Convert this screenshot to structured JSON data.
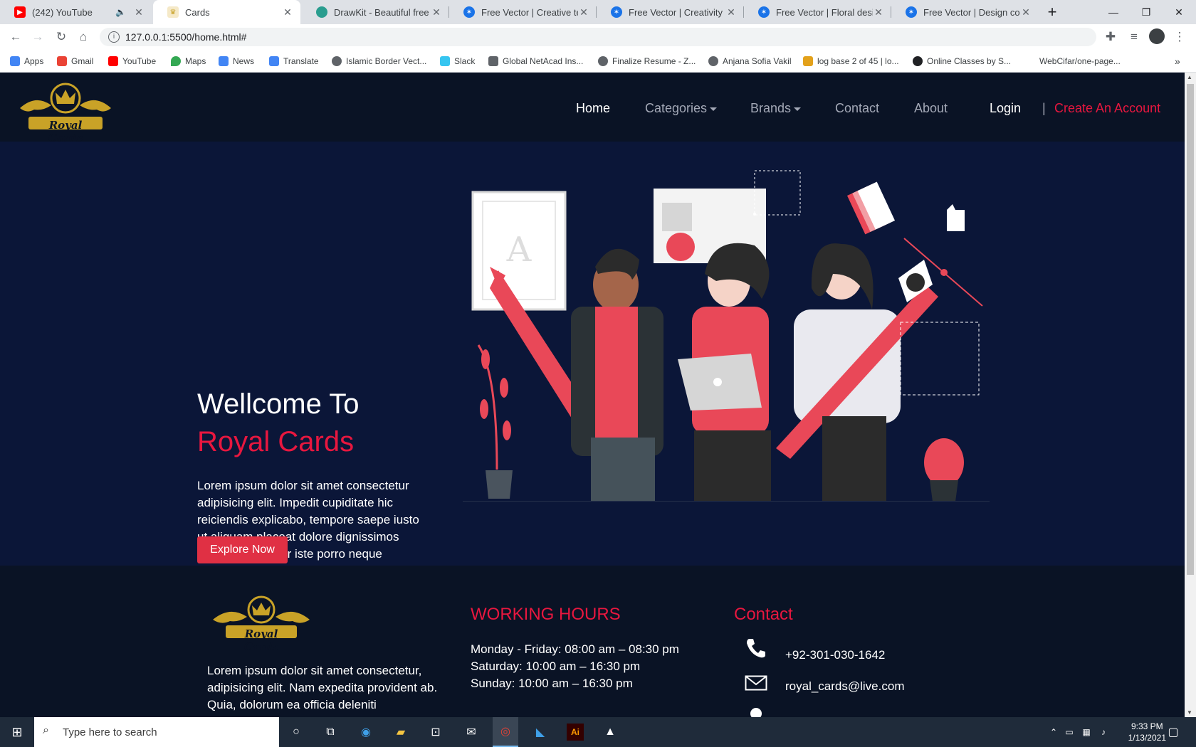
{
  "browser": {
    "tabs": [
      {
        "title": "(242) YouTube",
        "favicon": "youtube-icon",
        "color": "#ff0000"
      },
      {
        "title": "Cards",
        "favicon": "crown-icon",
        "color": "#c9a227"
      },
      {
        "title": "DrawKit - Beautiful free ve",
        "favicon": "drawkit-icon",
        "color": "#2a9d8f"
      },
      {
        "title": "Free Vector | Creative team",
        "favicon": "freepik-icon",
        "color": "#1a73e8"
      },
      {
        "title": "Free Vector | Creativity con",
        "favicon": "freepik-icon",
        "color": "#1a73e8"
      },
      {
        "title": "Free Vector | Floral design",
        "favicon": "freepik-icon",
        "color": "#1a73e8"
      },
      {
        "title": "Free Vector | Design comm",
        "favicon": "freepik-icon",
        "color": "#1a73e8"
      }
    ],
    "url": "127.0.0.1:5500/home.html#",
    "bookmarks": [
      {
        "label": "Apps",
        "color": "#4285f4"
      },
      {
        "label": "Gmail",
        "color": "#ea4335"
      },
      {
        "label": "YouTube",
        "color": "#ff0000"
      },
      {
        "label": "Maps",
        "color": "#34a853"
      },
      {
        "label": "News",
        "color": "#4285f4"
      },
      {
        "label": "Translate",
        "color": "#4285f4"
      },
      {
        "label": "Islamic Border Vect...",
        "color": "#5f6368"
      },
      {
        "label": "Slack",
        "color": "#36c5f0"
      },
      {
        "label": "Global NetAcad Ins...",
        "color": "#5f6368"
      },
      {
        "label": "Finalize Resume - Z...",
        "color": "#5f6368"
      },
      {
        "label": "Anjana Sofia Vakil",
        "color": "#5f6368"
      },
      {
        "label": "log base 2 of 45 | lo...",
        "color": "#e3a11b"
      },
      {
        "label": "Online Classes by S...",
        "color": "#202124"
      },
      {
        "label": "WebCifar/one-page...",
        "color": ""
      }
    ]
  },
  "site": {
    "logo_text": "Royal Cards",
    "nav": {
      "home": "Home",
      "categories": "Categories",
      "brands": "Brands",
      "contact": "Contact",
      "about": "About",
      "login": "Login",
      "divider": "|",
      "create": "Create An Account"
    },
    "hero": {
      "title_line1": "Wellcome To",
      "title_line2": "Royal Cards",
      "text": "Lorem ipsum dolor sit amet consectetur adipisicing elit. Impedit cupiditate hic reiciendis explicabo, tempore saepe iusto ut aliquam placeat dolore dignissimos repellat at tenetur iste porro neque repellendus modi quas!",
      "button": "Explore Now",
      "illustration_letter": "A"
    },
    "footer": {
      "logo_text": "Royal Cards",
      "about_text": "Lorem ipsum dolor sit amet consectetur, adipisicing elit. Nam expedita provident ab. Quia, dolorum ea officia deleniti",
      "hours_title": "WORKING HOURS",
      "hours": [
        "Monday - Friday: 08:00 am – 08:30 pm",
        "Saturday: 10:00 am – 16:30 pm",
        "Sunday: 10:00 am – 16:30 pm"
      ],
      "contact_title": "Contact",
      "phone": "+92-301-030-1642",
      "email": "royal_cards@live.com"
    }
  },
  "taskbar": {
    "search_placeholder": "Type here to search",
    "time": "9:33 PM",
    "date": "1/13/2021"
  },
  "colors": {
    "accent": "#e8173f",
    "navbar_bg": "#0a1325",
    "hero_bg": "#0b1638",
    "gold": "#c9a227"
  }
}
